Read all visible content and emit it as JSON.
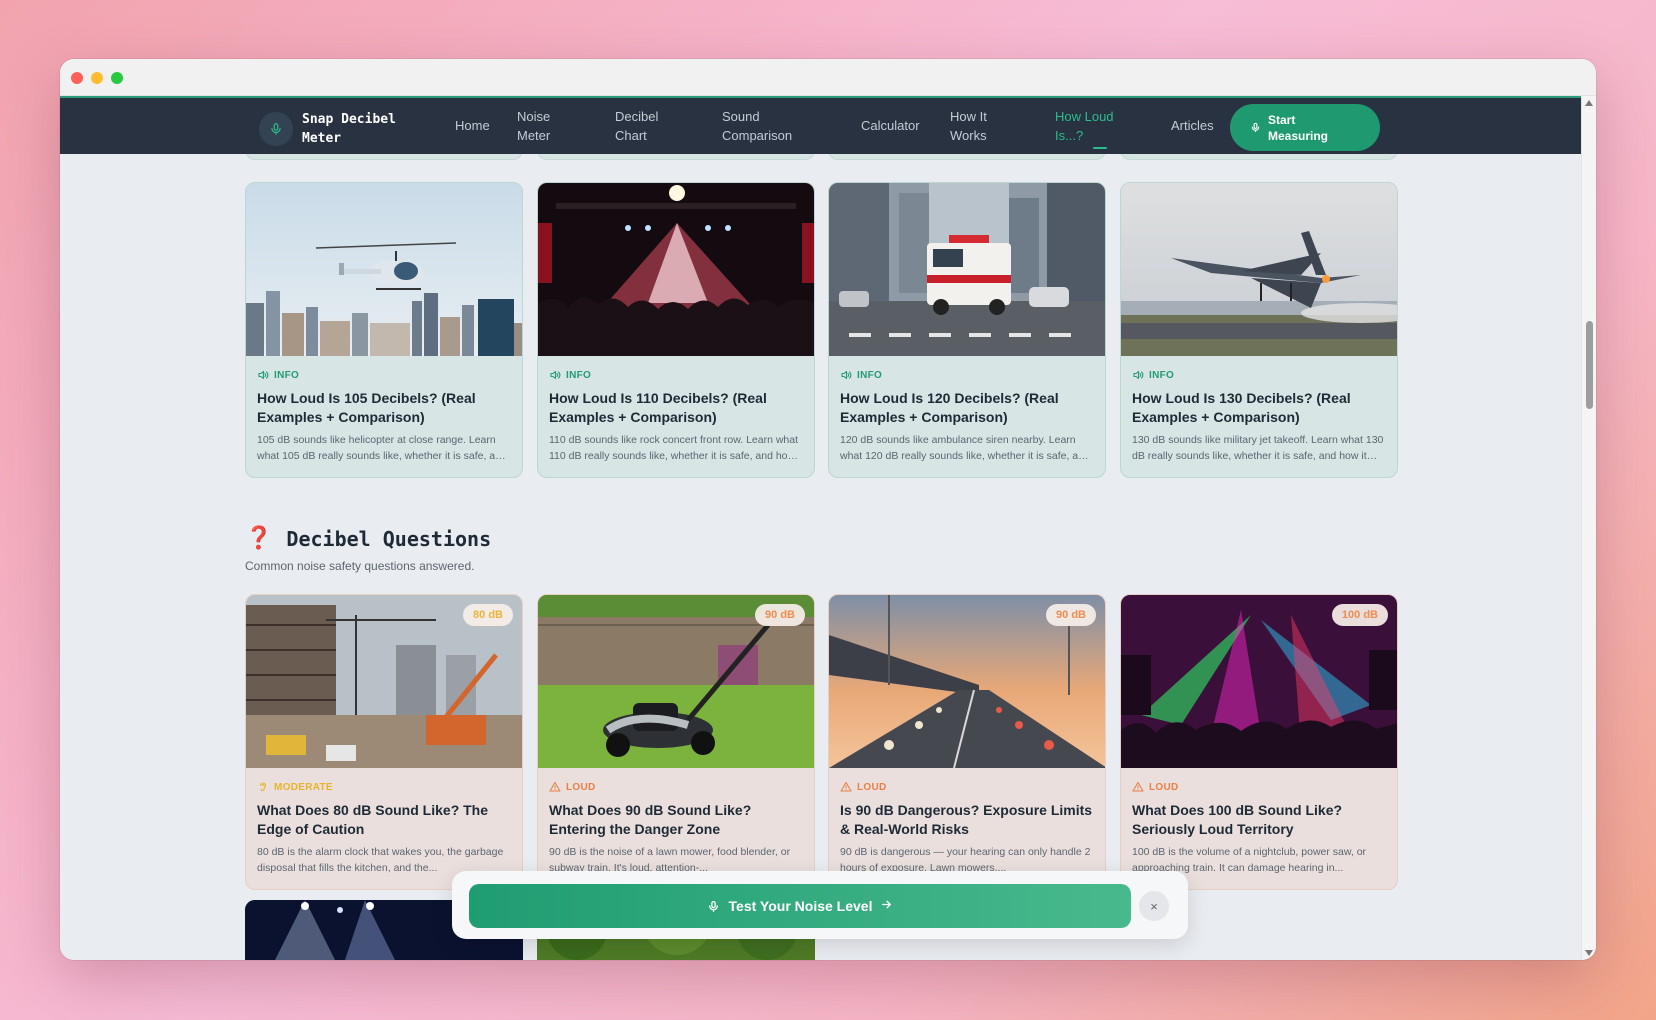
{
  "brand": {
    "name": "Snap Decibel Meter"
  },
  "nav": {
    "items": [
      {
        "label": "Home"
      },
      {
        "label": "Noise Meter"
      },
      {
        "label": "Decibel Chart"
      },
      {
        "label": "Sound Comparison"
      },
      {
        "label": "Calculator"
      },
      {
        "label": "How It Works"
      },
      {
        "label": "How Loud Is...?"
      },
      {
        "label": "Articles"
      }
    ],
    "active": "How Loud Is...?",
    "cta": "Start Measuring"
  },
  "how_loud_cards": [
    {
      "tag": "INFO",
      "title": "How Loud Is 105 Decibels? (Real Examples + Comparison)",
      "desc": "105 dB sounds like helicopter at close range. Learn what 105 dB really sounds like, whether it is safe, and how it compares."
    },
    {
      "tag": "INFO",
      "title": "How Loud Is 110 Decibels? (Real Examples + Comparison)",
      "desc": "110 dB sounds like rock concert front row. Learn what 110 dB really sounds like, whether it is safe, and how it compares."
    },
    {
      "tag": "INFO",
      "title": "How Loud Is 120 Decibels? (Real Examples + Comparison)",
      "desc": "120 dB sounds like ambulance siren nearby. Learn what 120 dB really sounds like, whether it is safe, and how it compares."
    },
    {
      "tag": "INFO",
      "title": "How Loud Is 130 Decibels? (Real Examples + Comparison)",
      "desc": "130 dB sounds like military jet takeoff. Learn what 130 dB really sounds like, whether it is safe, and how it compares."
    }
  ],
  "questions_section": {
    "icon": "❓",
    "title": "Decibel Questions",
    "subtitle": "Common noise safety questions answered."
  },
  "question_cards": [
    {
      "badge": "80 dB",
      "tag": "MODERATE",
      "title": "What Does 80 dB Sound Like? The Edge of Caution",
      "desc": "80 dB is the alarm clock that wakes you, the garbage disposal that fills the kitchen, and the..."
    },
    {
      "badge": "90 dB",
      "tag": "LOUD",
      "title": "What Does 90 dB Sound Like? Entering the Danger Zone",
      "desc": "90 dB is the noise of a lawn mower, food blender, or subway train. It's loud, attention-..."
    },
    {
      "badge": "90 dB",
      "tag": "LOUD",
      "title": "Is 90 dB Dangerous? Exposure Limits & Real-World Risks",
      "desc": "90 dB is dangerous — your hearing can only handle 2 hours of exposure. Lawn mowers,..."
    },
    {
      "badge": "100 dB",
      "tag": "LOUD",
      "title": "What Does 100 dB Sound Like? Seriously Loud Territory",
      "desc": "100 dB is the volume of a nightclub, power saw, or approaching train. It can damage hearing in..."
    }
  ],
  "sticky_bar": {
    "button": "Test Your Noise Level",
    "close": "×"
  },
  "colors": {
    "nav_bg": "#283240",
    "accent": "#2bbd8c",
    "moderate": "#e8b32c",
    "loud": "#e88145"
  }
}
